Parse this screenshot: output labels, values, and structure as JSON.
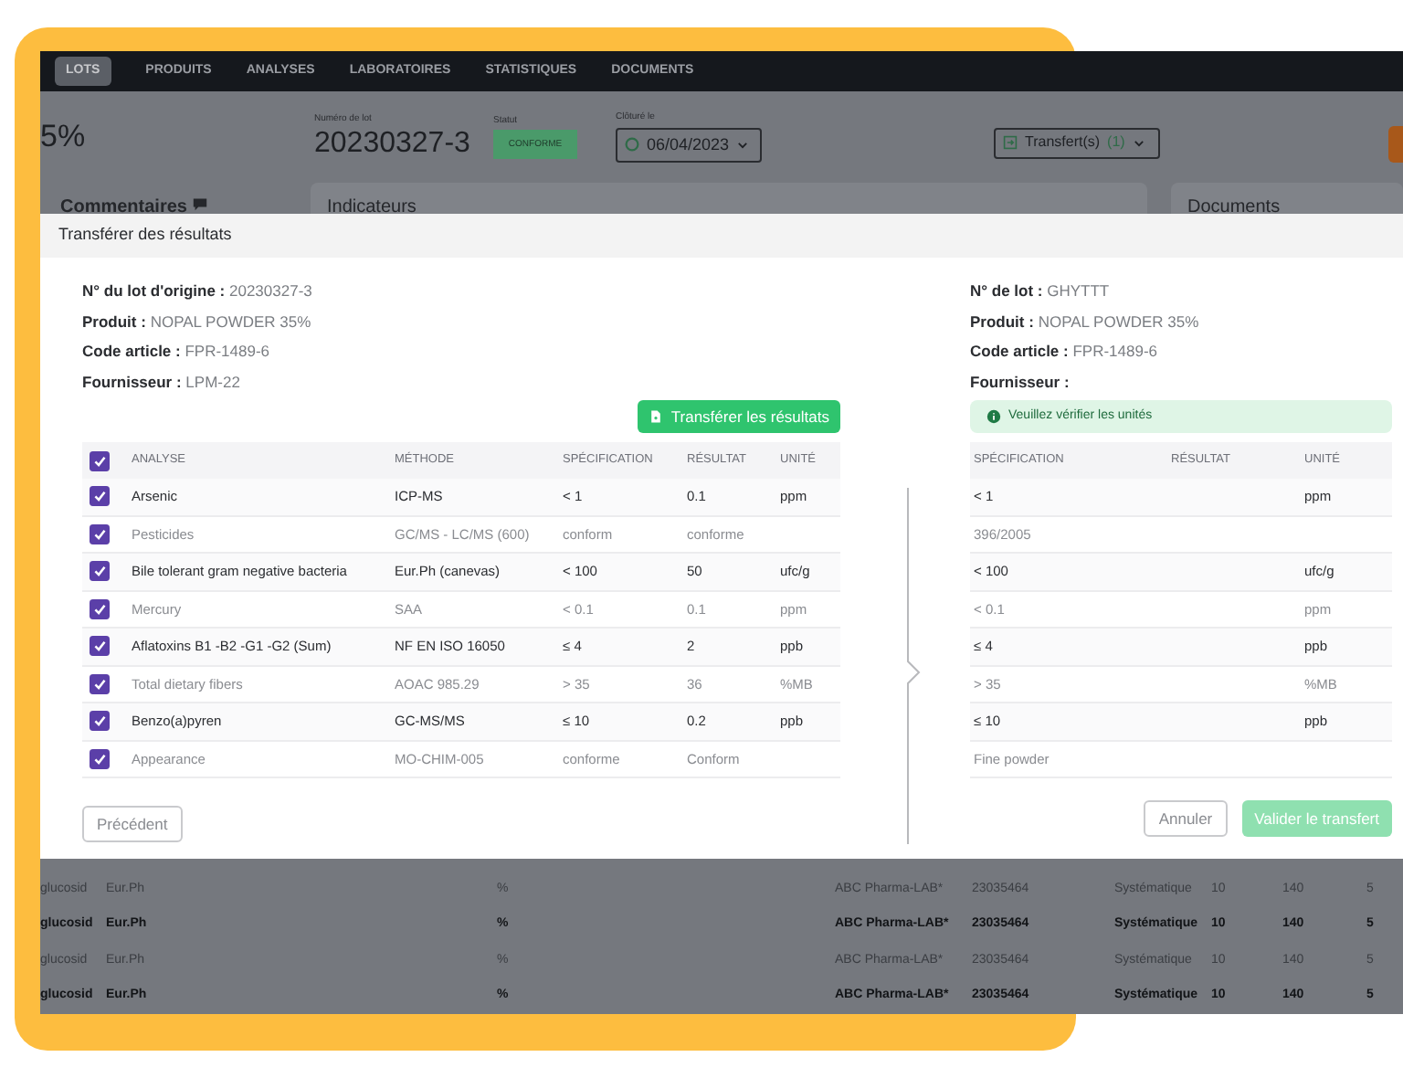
{
  "nav": {
    "tabs": [
      {
        "label": "LOTS",
        "selected": true
      },
      {
        "label": "PRODUITS",
        "selected": false
      },
      {
        "label": "ANALYSES",
        "selected": false
      },
      {
        "label": "LABORATOIRES",
        "selected": false
      },
      {
        "label": "STATISTIQUES",
        "selected": false
      },
      {
        "label": "DOCUMENTS",
        "selected": false
      }
    ]
  },
  "header": {
    "percent": "5%",
    "lot_label": "Numéro de lot",
    "lot_number": "20230327-3",
    "status_label": "Statut",
    "status": "CONFORME",
    "closed_label": "Clôturé le",
    "closed_date": "06/04/2023",
    "transfers_label": "Transfert(s)",
    "transfers_count": "(1)"
  },
  "panels": {
    "comments": "Commentaires",
    "indicators": "Indicateurs",
    "documents": "Documents"
  },
  "background_rows": [
    {
      "column_1": "glucosid",
      "method": "Eur.Ph",
      "unit": "%",
      "lab": "ABC Pharma-LAB*",
      "number": "23035464",
      "frequency": "Systématique",
      "column_7": "10",
      "column_8": "140",
      "column_9": "5",
      "strong": false
    },
    {
      "column_1": "glucosid",
      "method": "Eur.Ph",
      "unit": "%",
      "lab": "ABC Pharma-LAB*",
      "number": "23035464",
      "frequency": "Systématique",
      "column_7": "10",
      "column_8": "140",
      "column_9": "5",
      "strong": true
    },
    {
      "column_1": "glucosid",
      "method": "Eur.Ph",
      "unit": "%",
      "lab": "ABC Pharma-LAB*",
      "number": "23035464",
      "frequency": "Systématique",
      "column_7": "10",
      "column_8": "140",
      "column_9": "5",
      "strong": false
    },
    {
      "column_1": "glucosid",
      "method": "Eur.Ph",
      "unit": "%",
      "lab": "ABC Pharma-LAB*",
      "number": "23035464",
      "frequency": "Systématique",
      "column_7": "10",
      "column_8": "140",
      "column_9": "5",
      "strong": true
    }
  ],
  "modal": {
    "title": "Transférer des résultats",
    "source": {
      "fields": [
        {
          "label": "N° du lot d'origine :",
          "value": "20230327-3"
        },
        {
          "label": "Produit :",
          "value": "NOPAL POWDER 35%"
        },
        {
          "label": "Code article :",
          "value": "FPR-1489-6"
        },
        {
          "label": "Fournisseur :",
          "value": "LPM-22"
        }
      ],
      "transfer_button": "Transférer les résultats",
      "select_all_checked": true,
      "columns": [
        "ANALYSE",
        "MÉTHODE",
        "SPÉCIFICATION",
        "RÉSULTAT",
        "UNITÉ"
      ],
      "rows": [
        {
          "checked": true,
          "strong": true,
          "analysis": "Arsenic",
          "method": "ICP-MS",
          "specification": "< 1",
          "result": "0.1",
          "unit": "ppm"
        },
        {
          "checked": true,
          "strong": false,
          "analysis": "Pesticides",
          "method": "GC/MS - LC/MS (600)",
          "specification": "conform",
          "result": "conforme"
        },
        {
          "checked": true,
          "strong": true,
          "analysis": "Bile tolerant gram negative bacteria",
          "method": "Eur.Ph (canevas)",
          "specification": "< 100",
          "result": "50",
          "unit": "ufc/g"
        },
        {
          "checked": true,
          "strong": false,
          "analysis": "Mercury",
          "method": "SAA",
          "specification": "< 0.1",
          "result": "0.1",
          "unit": "ppm"
        },
        {
          "checked": true,
          "strong": true,
          "analysis": "Aflatoxins B1 -B2 -G1 -G2 (Sum)",
          "method": "NF EN ISO 16050",
          "specification": "≤ 4",
          "result": "2",
          "unit": "ppb"
        },
        {
          "checked": true,
          "strong": false,
          "analysis": "Total dietary fibers",
          "method": "AOAC 985.29",
          "specification": "> 35",
          "result": "36",
          "unit": "%MB"
        },
        {
          "checked": true,
          "strong": true,
          "analysis": "Benzo(a)pyren",
          "method": "GC-MS/MS",
          "specification": "≤ 10",
          "result": "0.2",
          "unit": "ppb"
        },
        {
          "checked": true,
          "strong": false,
          "analysis": "Appearance",
          "method": "MO-CHIM-005",
          "specification": "conforme",
          "result": "Conform"
        }
      ],
      "back_button": "Précédent"
    },
    "target": {
      "fields": [
        {
          "label": "N° de lot :",
          "value": "GHYTTT"
        },
        {
          "label": "Produit :",
          "value": "NOPAL POWDER 35%"
        },
        {
          "label": "Code article :",
          "value": "FPR-1489-6"
        },
        {
          "label": "Fournisseur :"
        }
      ],
      "alert": "Veuillez vérifier les unités",
      "columns": [
        "SPÉCIFICATION",
        "RÉSULTAT",
        "UNITÉ"
      ],
      "rows": [
        {
          "strong": true,
          "specification": "< 1",
          "unit": "ppm"
        },
        {
          "strong": false,
          "specification": "396/2005"
        },
        {
          "strong": true,
          "specification": "< 100",
          "unit": "ufc/g"
        },
        {
          "strong": false,
          "specification": "< 0.1",
          "unit": "ppm"
        },
        {
          "strong": true,
          "specification": "≤ 4",
          "unit": "ppb"
        },
        {
          "strong": false,
          "specification": "> 35",
          "unit": "%MB"
        },
        {
          "strong": true,
          "specification": "≤ 10",
          "unit": "ppb"
        },
        {
          "strong": false,
          "specification": "Fine powder"
        }
      ],
      "cancel_button": "Annuler",
      "confirm_button": "Valider le transfert"
    }
  }
}
